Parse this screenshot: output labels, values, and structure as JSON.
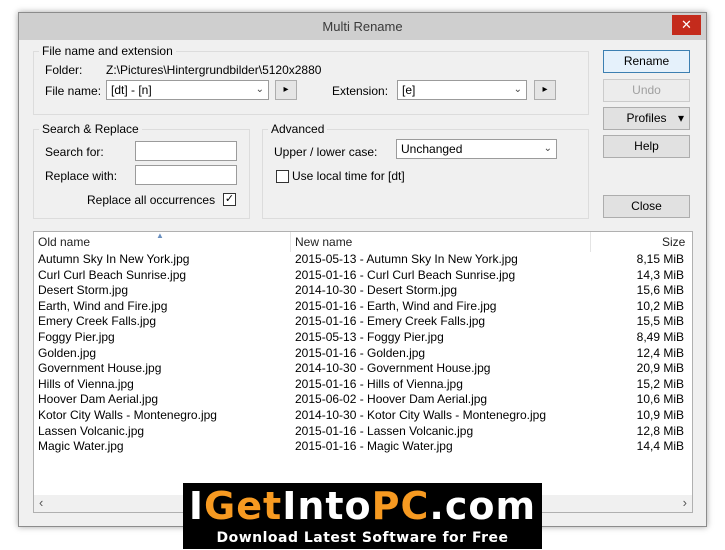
{
  "window": {
    "title": "Multi Rename",
    "close_glyph": "✕"
  },
  "file_group": {
    "title": "File name and extension",
    "folder_label": "Folder:",
    "folder_value": "Z:\\Pictures\\Hintergrundbilder\\5120x2880",
    "filename_label": "File name:",
    "filename_value": "[dt] - [n]",
    "extension_label": "Extension:",
    "extension_value": "[e]",
    "arrow_glyph": "▸",
    "dropdown_glyph": "⌄"
  },
  "search_group": {
    "title": "Search & Replace",
    "search_label": "Search for:",
    "search_value": "",
    "replace_label": "Replace with:",
    "replace_value": "",
    "replace_all_label": "Replace all occurrences",
    "replace_all_checked": true,
    "check_glyph": "✓"
  },
  "advanced_group": {
    "title": "Advanced",
    "case_label": "Upper / lower case:",
    "case_value": "Unchanged",
    "local_time_label": "Use local time for [dt]",
    "local_time_checked": false
  },
  "buttons": {
    "rename": "Rename",
    "undo": "Undo",
    "profiles": "Profiles",
    "profiles_arrow": "▾",
    "help": "Help",
    "close": "Close"
  },
  "file_list": {
    "columns": {
      "old": "Old name",
      "new": "New name",
      "size": "Size"
    },
    "sort_indicator": "▲",
    "rows": [
      {
        "old": "Autumn Sky In New York.jpg",
        "new": "2015-05-13 - Autumn Sky In New York.jpg",
        "size": "8,15 MiB"
      },
      {
        "old": "Curl Curl Beach Sunrise.jpg",
        "new": "2015-01-16 - Curl Curl Beach Sunrise.jpg",
        "size": "14,3 MiB"
      },
      {
        "old": "Desert Storm.jpg",
        "new": "2014-10-30 - Desert Storm.jpg",
        "size": "15,6 MiB"
      },
      {
        "old": "Earth, Wind and Fire.jpg",
        "new": "2015-01-16 - Earth, Wind and Fire.jpg",
        "size": "10,2 MiB"
      },
      {
        "old": "Emery Creek Falls.jpg",
        "new": "2015-01-16 - Emery Creek Falls.jpg",
        "size": "15,5 MiB"
      },
      {
        "old": "Foggy Pier.jpg",
        "new": "2015-05-13 - Foggy Pier.jpg",
        "size": "8,49 MiB"
      },
      {
        "old": "Golden.jpg",
        "new": "2015-01-16 - Golden.jpg",
        "size": "12,4 MiB"
      },
      {
        "old": "Government House.jpg",
        "new": "2014-10-30 - Government House.jpg",
        "size": "20,9 MiB"
      },
      {
        "old": "Hills of Vienna.jpg",
        "new": "2015-01-16 - Hills of Vienna.jpg",
        "size": "15,2 MiB"
      },
      {
        "old": "Hoover Dam Aerial.jpg",
        "new": "2015-06-02 - Hoover Dam Aerial.jpg",
        "size": "10,6 MiB"
      },
      {
        "old": "Kotor City Walls - Montenegro.jpg",
        "new": "2014-10-30 - Kotor City Walls - Montenegro.jpg",
        "size": "10,9 MiB"
      },
      {
        "old": "Lassen Volcanic.jpg",
        "new": "2015-01-16 - Lassen Volcanic.jpg",
        "size": "12,8 MiB"
      },
      {
        "old": "Magic Water.jpg",
        "new": "2015-01-16 - Magic Water.jpg",
        "size": "14,4 MiB"
      }
    ],
    "scroll_left": "‹",
    "scroll_right": "›"
  },
  "watermark": {
    "top_white_1": "I",
    "top_orange_1": "Get",
    "top_white_2": "Into",
    "top_orange_2": "PC",
    "top_white_3": ".com",
    "bottom": "Download Latest Software for Free"
  }
}
